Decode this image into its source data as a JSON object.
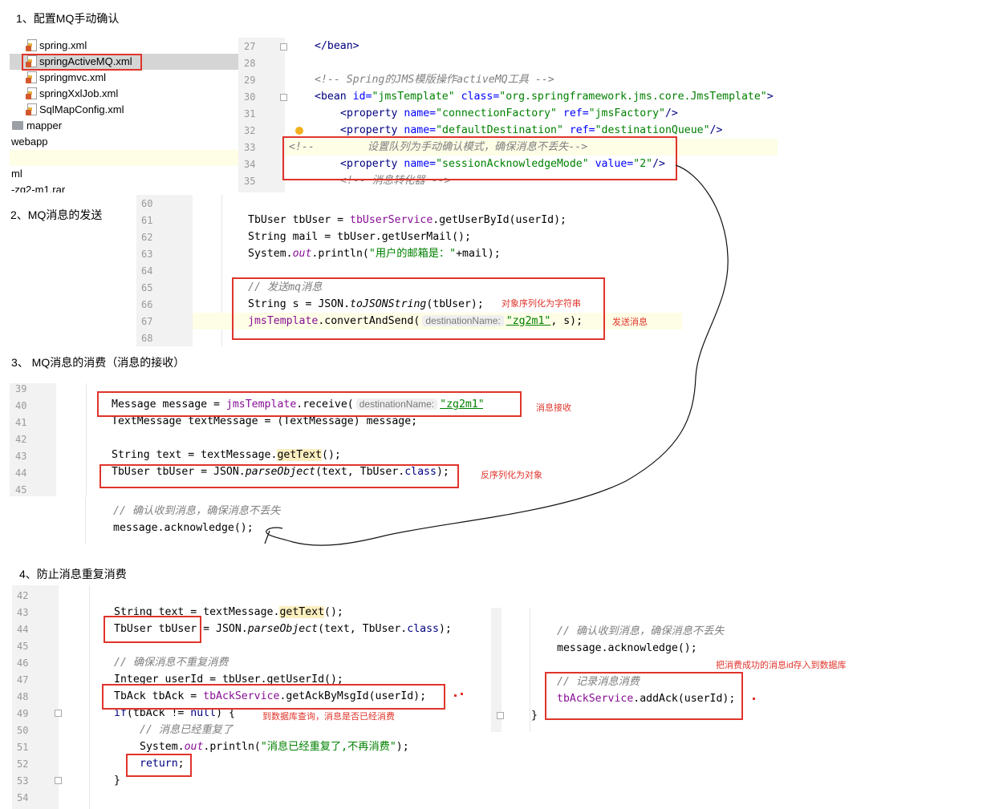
{
  "headings": {
    "h1": "1、配置MQ手动确认",
    "h2": "2、MQ消息的发送",
    "h3": "3、 MQ消息的消费（消息的接收）",
    "h4": "4、防止消息重复消费"
  },
  "file_tree": {
    "spring": "spring.xml",
    "springActiveMQ": "springActiveMQ.xml",
    "springmvc": "springmvc.xml",
    "springXxlJob": "springXxlJob.xml",
    "sqlMapConfig": "SqlMapConfig.xml",
    "mapper": "mapper",
    "webapp": "webapp",
    "ml": "ml",
    "zg2": "-zg2-m1.rar"
  },
  "editor1": {
    "line_numbers": [
      "27",
      "28",
      "29",
      "30",
      "31",
      "32",
      "33",
      "34",
      "35"
    ],
    "l27": "</bean>",
    "l29": "<!-- Spring的JMS模版操作activeMQ工具 -->",
    "l30_open": "<bean ",
    "l30_id_attr": "id=",
    "l30_id_val": "\"jmsTemplate\"",
    "l30_class_attr": " class=",
    "l30_class_val": "\"org.springframework.jms.core.JmsTemplate\"",
    "l30_close": ">",
    "prop_open": "<property ",
    "name_attr": "name=",
    "ref_attr": " ref=",
    "value_attr": " value=",
    "self_close": "/>",
    "l31_name": "\"connectionFactory\"",
    "l31_ref": "\"jmsFactory\"",
    "l32_name": "\"defaultDestination\"",
    "l32_ref": "\"destinationQueue\"",
    "l33_open": "<!--",
    "l33_text": "设置队列为手动确认模式，确保消息不丢失-->",
    "l34_name": "\"sessionAcknowledgeMode\"",
    "l34_value": "\"2\"",
    "l35": "<!-- 消息转化器 -->"
  },
  "editor2": {
    "line_numbers": [
      "60",
      "61",
      "62",
      "63",
      "64",
      "65",
      "66",
      "67",
      "68"
    ],
    "l61_a": "TbUser tbUser = ",
    "l61_b": "tbUserService",
    "l61_c": ".getUserById(userId);",
    "l62": "String mail = tbUser.getUserMail();",
    "l63_a": "System.",
    "l63_b": "out",
    "l63_c": ".println(",
    "l63_d": "\"用户的邮箱是：\"",
    "l63_e": "+mail);",
    "l65": "// 发送mq消息",
    "l66_a": "String s = JSON.",
    "l66_b": "toJSONString",
    "l66_c": "(tbUser);",
    "l67_a": "jmsTemplate",
    "l67_b": ".convertAndSend(",
    "l67_hint": "destinationName:",
    "l67_str": "\"zg2m1\"",
    "l67_c": ", s);"
  },
  "editor3": {
    "line_numbers": [
      "39",
      "40",
      "41",
      "42",
      "43",
      "44",
      "45"
    ],
    "l40_a": "Message message = ",
    "l40_b": "jmsTemplate",
    "l40_c": ".receive(",
    "l40_hint": "destinationName:",
    "l40_str": "\"zg2m1\"",
    "l40_d": ");",
    "l41": "TextMessage textMessage = (TextMessage) message;",
    "l43_a": "String text = textMessage.",
    "l43_b": "getText",
    "l43_c": "();",
    "l44_a": "TbUser tbUser = JSON.",
    "l44_b": "parseObject",
    "l44_c": "(text, TbUser.",
    "l44_d": "class",
    "l44_e": ");",
    "ack_comment": "// 确认收到消息，确保消息不丢失",
    "ack_call": "message.acknowledge();"
  },
  "editor4": {
    "line_numbers": [
      "42",
      "43",
      "44",
      "45",
      "46",
      "47",
      "48",
      "49",
      "50",
      "51",
      "52",
      "53",
      "54"
    ],
    "l43_a": "String text = textMessage.",
    "l43_b": "getText",
    "l43_c": "();",
    "l44_a": "TbUser tbUser",
    "l44_b": " = JSON.",
    "l44_c": "parseObject",
    "l44_d": "(text, TbUser.",
    "l44_e": "class",
    "l44_f": ");",
    "l46": "// 确保消息不重复消费",
    "l47": "Integer userId = tbUser.getUserId();",
    "l48_a": "TbAck tbAck = ",
    "l48_b": "tbAckService",
    "l48_c": ".getAckByMsgId(userId);",
    "l49_a": "if",
    "l49_b": "(tbAck != ",
    "l49_c": "null",
    "l49_d": ") {",
    "l50": "// 消息已经重复了",
    "l51_a": "System.",
    "l51_b": "out",
    "l51_c": ".println(",
    "l51_d": "\"消息已经重复了,不再消费\"",
    "l51_e": ");",
    "l52_a": "return",
    "l52_b": ";",
    "l53": "}"
  },
  "editor5": {
    "ack_comment": "// 确认收到消息，确保消息不丢失",
    "ack_call": "message.acknowledge();",
    "rec_comment": "// 记录消息消费",
    "rec_a": "tbAckService",
    "rec_b": ".addAck(userId);",
    "close": "}"
  },
  "annotations": {
    "serialize": "对象序列化为字符串",
    "send": "发送消息",
    "receive": "消息接收",
    "deserialize": "反序列化为对象",
    "db_query": "到数据库查询，消息是否已经消费",
    "store_id": "把消费成功的消息id存入到数据库"
  },
  "colors": {
    "annotation_red": "#e0342b",
    "keyword": "#000080",
    "string": "#008000",
    "field": "#871094",
    "comment": "#808080",
    "gutter": "#f2f2f2"
  }
}
